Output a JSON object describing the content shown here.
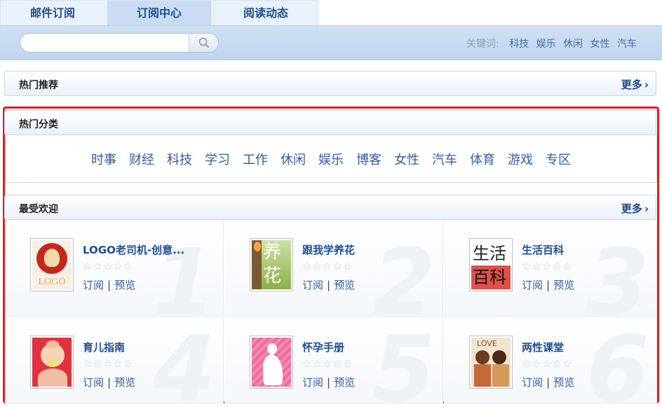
{
  "tabs": [
    {
      "label": "邮件订阅"
    },
    {
      "label": "订阅中心"
    },
    {
      "label": "阅读动态"
    }
  ],
  "search": {
    "placeholder": "",
    "value": ""
  },
  "keywords": {
    "label": "关键词:",
    "items": [
      "科技",
      "娱乐",
      "休闲",
      "女性",
      "汽车"
    ]
  },
  "hot_recommend": {
    "title": "热门推荐",
    "more": "更多"
  },
  "hot_categories": {
    "title": "热门分类",
    "items": [
      "时事",
      "财经",
      "科技",
      "学习",
      "工作",
      "休闲",
      "娱乐",
      "博客",
      "女性",
      "汽车",
      "体育",
      "游戏",
      "专区"
    ]
  },
  "favorites": {
    "title": "最受欢迎",
    "more": "更多",
    "subscribe_label": "订阅",
    "preview_label": "预览",
    "stars": "☆☆☆☆☆",
    "items": [
      {
        "rank": "1",
        "name": "LOGO老司机-创意...",
        "thumb_text": "LOGO"
      },
      {
        "rank": "2",
        "name": "跟我学养花",
        "thumb_text": "养花"
      },
      {
        "rank": "3",
        "name": "生活百科",
        "thumb_text": "生活百科"
      },
      {
        "rank": "4",
        "name": "育儿指南",
        "thumb_text": ""
      },
      {
        "rank": "5",
        "name": "怀孕手册",
        "thumb_text": ""
      },
      {
        "rank": "6",
        "name": "两性课堂",
        "thumb_text": "LOVE"
      }
    ]
  },
  "colors": {
    "accent": "#1d4f95",
    "highlight_frame": "#e0201b"
  }
}
